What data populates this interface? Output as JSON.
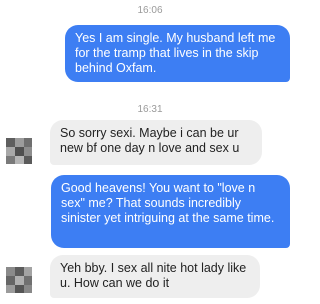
{
  "conversation": {
    "messages": [
      {
        "kind": "timestamp",
        "text": "16:06"
      },
      {
        "kind": "outgoing",
        "text": "Yes I am single. My husband left me for the tramp that lives in the skip behind Oxfam."
      },
      {
        "kind": "timestamp",
        "text": "16:31"
      },
      {
        "kind": "incoming",
        "text": "So sorry sexi. Maybe i can be ur new bf one day n love and sex u"
      },
      {
        "kind": "outgoing",
        "text": "Good heavens! You want to \"love n sex\" me? That sounds incredibly sinister yet intriguing at the same time."
      },
      {
        "kind": "incoming",
        "text": "Yeh bby. I sex all nite hot lady like u. How can we do it"
      }
    ]
  },
  "colors": {
    "outgoing_bubble": "#3d7ef3",
    "incoming_bubble": "#eeeeee",
    "timestamp_text": "#9a9a9a"
  },
  "icons": {
    "avatar": "blurred-avatar-icon"
  }
}
